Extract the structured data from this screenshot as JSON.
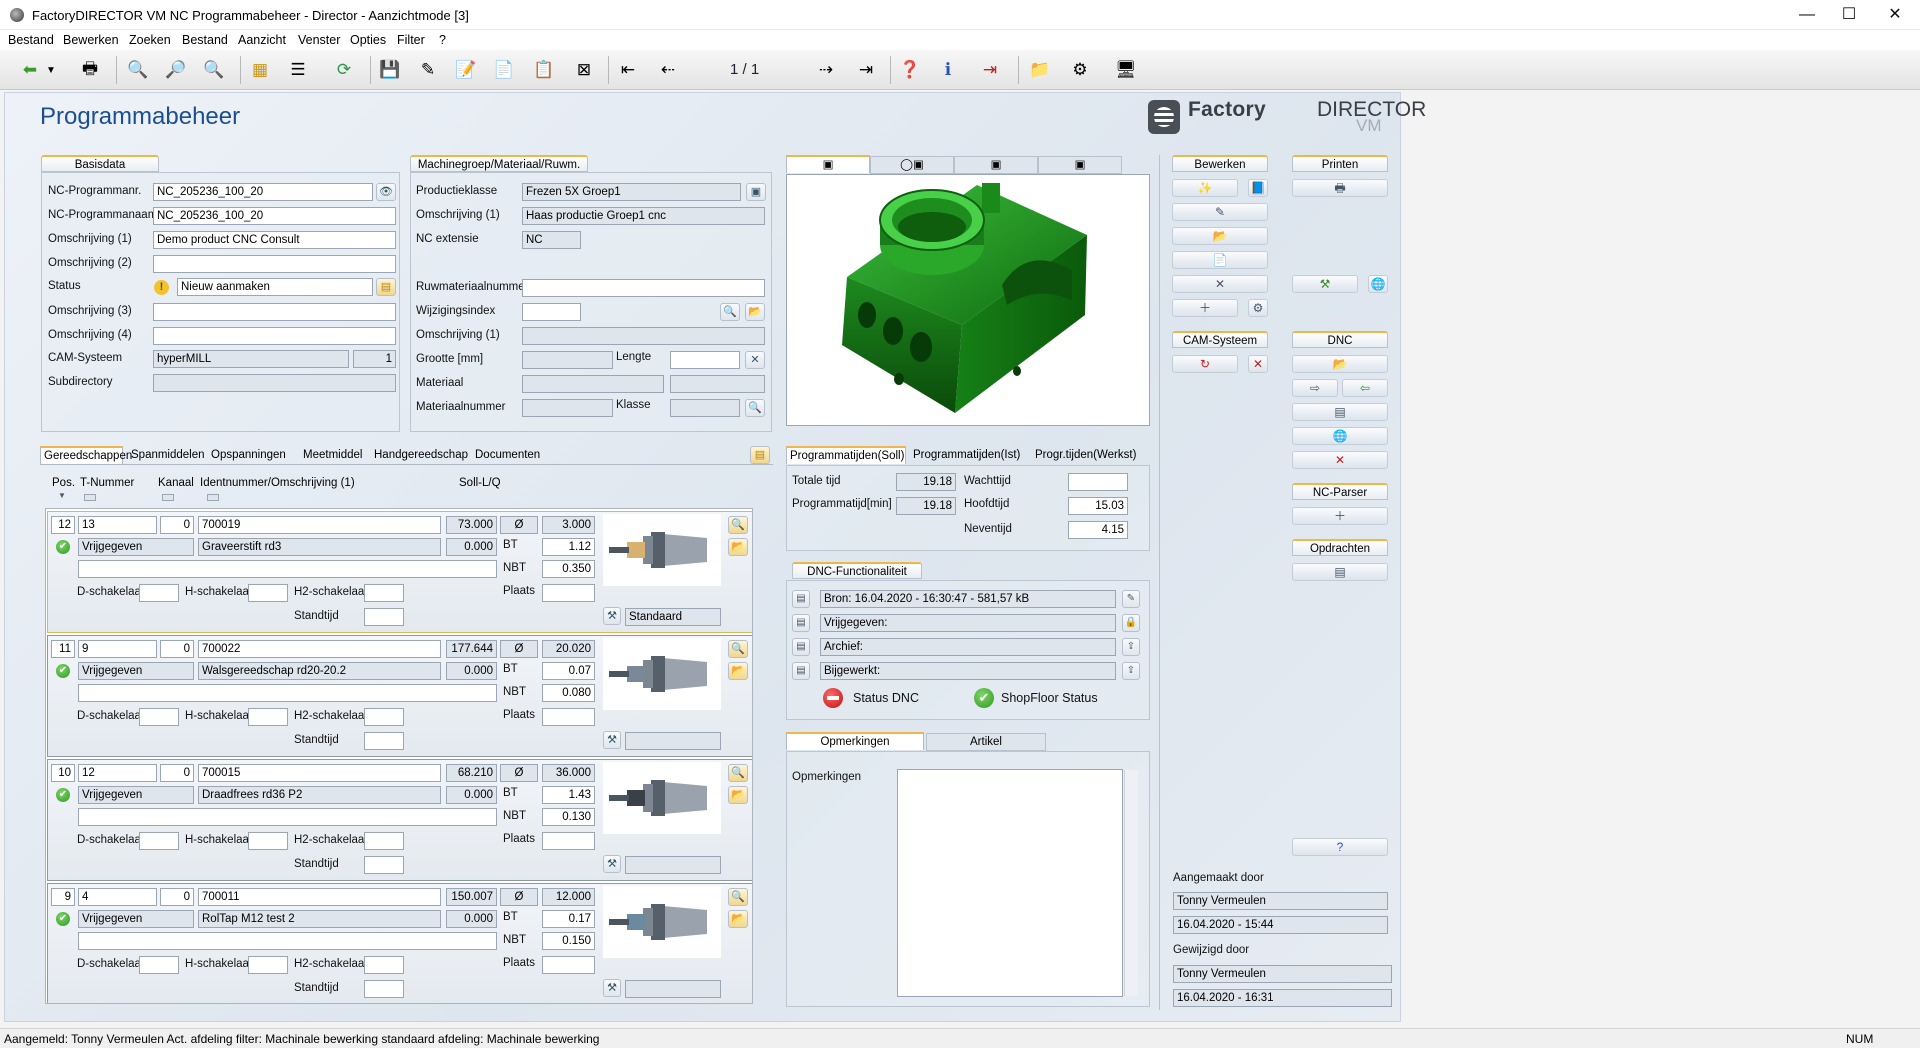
{
  "window": {
    "title": "FactoryDIRECTOR VM NC Programmabeheer - Director - Aanzichtmode [3]",
    "minimize": "—",
    "maximize": "☐",
    "close": "✕"
  },
  "menu": [
    "Bestand",
    "Bewerken",
    "Zoeken",
    "Bestand",
    "Aanzicht",
    "Venster",
    "Opties",
    "Filter",
    "?"
  ],
  "toolbar": {
    "pager": "1 / 1"
  },
  "page": {
    "title": "Programmabeheer",
    "logo": {
      "t1": "Factory",
      "t2": "DIRECTOR",
      "t3": "VM"
    }
  },
  "basisdata": {
    "tab": "Basisdata",
    "labels": [
      "NC-Programmanr.",
      "NC-Programmanaam",
      "Omschrijving (1)",
      "Omschrijving (2)",
      "Status",
      "Omschrijving (3)",
      "Omschrijving (4)",
      "CAM-Systeem",
      "Subdirectory"
    ],
    "nc_nr": "NC_205236_100_20",
    "nc_naam": "NC_205236_100_20",
    "omschr1": "Demo product CNC Consult",
    "omschr2": "",
    "status": "Nieuw aanmaken",
    "omschr3": "",
    "omschr4": "",
    "cam": "hyperMILL",
    "cam_nr": "1",
    "subdir": ""
  },
  "machinegroep": {
    "tab": "Machinegroep/Materiaal/Ruwm.",
    "labels": {
      "productieklasse": "Productieklasse",
      "omschr1": "Omschrijving (1)",
      "ncext": "NC extensie",
      "ruw": "Ruwmateriaalnummer",
      "wijz": "Wijzigingsindex",
      "omschr1b": "Omschrijving (1)",
      "grootte": "Grootte [mm]",
      "lengte": "Lengte",
      "materiaal": "Materiaal",
      "matnr": "Materiaalnummer",
      "klasse": "Klasse"
    },
    "productieklasse": "Frezen 5X Groep1",
    "omschr1": "Haas productie Groep1 cnc",
    "ncext": "NC"
  },
  "tooltabs": [
    "Gereedschappen",
    "Spanmiddelen",
    "Opspanningen",
    "Meetmiddel",
    "Handgereedschap",
    "Documenten"
  ],
  "toolheaders": {
    "pos": "Pos.",
    "tnum": "T-Nummer",
    "kanaal": "Kanaal",
    "ident": "Identnummer/Omschrijving (1)",
    "soll": "Soll-L/Q"
  },
  "toollabels": {
    "d": "D-schakelaar",
    "h": "H-schakelaar",
    "h2": "H2-schakelaar",
    "stand": "Standtijd",
    "bt": "BT",
    "nbt": "NBT",
    "plaats": "Plaats",
    "dia": "Ø"
  },
  "tools": [
    {
      "pos": "12",
      "tnum": "13",
      "kanaal": "0",
      "ident": "700019",
      "soll": "73.000",
      "dia": "3.000",
      "status": "Vrijgegeven",
      "omschr": "Graveerstift rd3",
      "q": "0.000",
      "bt": "1.12",
      "nbt": "0.350",
      "holder": "Standaard"
    },
    {
      "pos": "11",
      "tnum": "9",
      "kanaal": "0",
      "ident": "700022",
      "soll": "177.644",
      "dia": "20.020",
      "status": "Vrijgegeven",
      "omschr": "Walsgereedschap rd20-20.2",
      "q": "0.000",
      "bt": "0.07",
      "nbt": "0.080",
      "holder": ""
    },
    {
      "pos": "10",
      "tnum": "12",
      "kanaal": "0",
      "ident": "700015",
      "soll": "68.210",
      "dia": "36.000",
      "status": "Vrijgegeven",
      "omschr": "Draadfrees rd36 P2",
      "q": "0.000",
      "bt": "1.43",
      "nbt": "0.130",
      "holder": ""
    },
    {
      "pos": "9",
      "tnum": "4",
      "kanaal": "0",
      "ident": "700011",
      "soll": "150.007",
      "dia": "12.000",
      "status": "Vrijgegeven",
      "omschr": "RolTap M12 test 2",
      "q": "0.000",
      "bt": "0.17",
      "nbt": "0.150",
      "holder": ""
    }
  ],
  "progtabs": [
    "Programmatijden(Soll)",
    "Programmatijden(Ist)",
    "Progr.tijden(Werkst)"
  ],
  "times": {
    "totale": "Totale tijd",
    "totale_v": "19.18",
    "prog": "Programmatijd[min]",
    "prog_v": "19.18",
    "wacht": "Wachttijd",
    "wacht_v": "",
    "hoofd": "Hoofdtijd",
    "hoofd_v": "15.03",
    "neven": "Neventijd",
    "neven_v": "4.15"
  },
  "dnc": {
    "tab": "DNC-Functionaliteit",
    "bron": "Bron: 16.04.2020 - 16:30:47 - 581,57 kB",
    "vrij": "Vrijgegeven:",
    "archief": "Archief:",
    "bijgewerkt": "Bijgewerkt:",
    "status_dnc": "Status DNC",
    "shopfloor": "ShopFloor Status"
  },
  "opm": {
    "tabs": [
      "Opmerkingen",
      "Artikel"
    ],
    "label": "Opmerkingen",
    "text": ""
  },
  "side": {
    "bewerken": "Bewerken",
    "printen": "Printen",
    "cam": "CAM-Systeem",
    "dnc": "DNC",
    "ncparser": "NC-Parser",
    "opdrachten": "Opdrachten",
    "aangemaakt": "Aangemaakt door",
    "aangemaakt_naam": "Tonny Vermeulen",
    "aangemaakt_datum": "16.04.2020 - 15:44",
    "gewijzigd": "Gewijzigd door",
    "gewijzigd_naam": "Tonny Vermeulen",
    "gewijzigd_datum": "16.04.2020 - 16:31"
  },
  "statusbar": {
    "msg": "Aangemeld: Tonny Vermeulen  Act. afdeling filter: Machinale bewerking standaard afdeling: Machinale bewerking",
    "num": "NUM"
  },
  "colors": {
    "title_blue": "#1d4f8f",
    "tab_accent": "#f0b64a",
    "part_green": "#1f8a1f",
    "panel": "#e2e9f1"
  }
}
